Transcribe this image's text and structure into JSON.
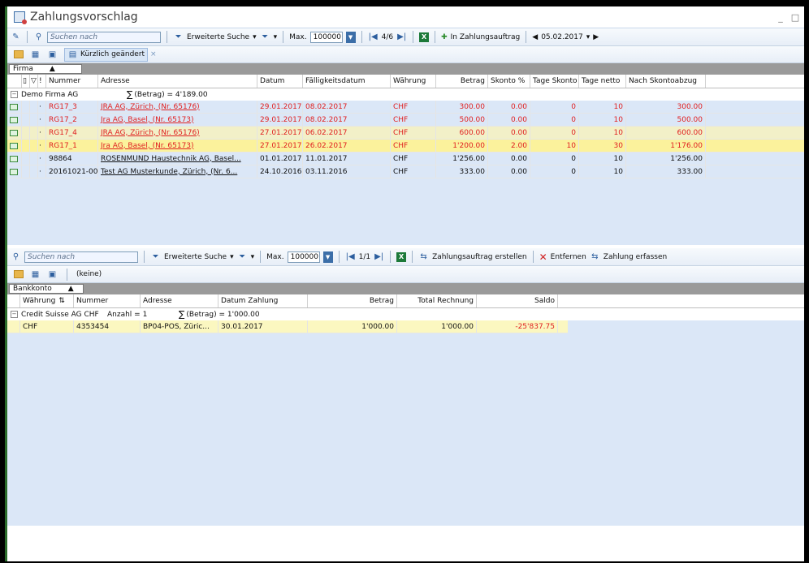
{
  "window": {
    "title": "Zahlungsvorschlag",
    "min_btn": "_",
    "max_btn": "□"
  },
  "top_toolbar": {
    "search_placeholder": "Suchen nach",
    "extended_search": "Erweiterte Suche",
    "max_label": "Max.",
    "max_value": "100000",
    "page": "4/6",
    "to_order": "In Zahlungsauftrag",
    "date": "05.02.2017"
  },
  "top_toolbar2": {
    "recent": "Kürzlich geändert",
    "close": "×"
  },
  "top_group": {
    "field": "Firma"
  },
  "top_columns": [
    "Nummer",
    "Adresse",
    "Datum",
    "Fälligkeitsdatum",
    "Währung",
    "Betrag",
    "Skonto %",
    "Tage Skonto",
    "Tage netto",
    "Nach Skontoabzug"
  ],
  "top_grouprow": {
    "company": "Demo Firma AG",
    "sum": "(Betrag) = 4'189.00"
  },
  "top_rows": [
    {
      "nummer": "RG17_3",
      "adresse": "JRA AG, Zürich, (Nr. 65176)",
      "datum": "29.01.2017",
      "faellig": "08.02.2017",
      "waehrung": "CHF",
      "betrag": "300.00",
      "skonto": "0.00",
      "tage_skonto": "0",
      "tage_netto": "10",
      "nach": "300.00",
      "style": "red",
      "bg": "#dbe7f7"
    },
    {
      "nummer": "RG17_2",
      "adresse": "Jra AG, Basel, (Nr. 65173)",
      "datum": "29.01.2017",
      "faellig": "08.02.2017",
      "waehrung": "CHF",
      "betrag": "500.00",
      "skonto": "0.00",
      "tage_skonto": "0",
      "tage_netto": "10",
      "nach": "500.00",
      "style": "red",
      "bg": "#dbe7f7"
    },
    {
      "nummer": "RG17_4",
      "adresse": "JRA AG, Zürich, (Nr. 65176)",
      "datum": "27.01.2017",
      "faellig": "06.02.2017",
      "waehrung": "CHF",
      "betrag": "600.00",
      "skonto": "0.00",
      "tage_skonto": "0",
      "tage_netto": "10",
      "nach": "600.00",
      "style": "red",
      "bg": "#f2f0c8"
    },
    {
      "nummer": "RG17_1",
      "adresse": "Jra AG, Basel, (Nr. 65173)",
      "datum": "27.01.2017",
      "faellig": "26.02.2017",
      "waehrung": "CHF",
      "betrag": "1'200.00",
      "skonto": "2.00",
      "tage_skonto": "10",
      "tage_netto": "30",
      "nach": "1'176.00",
      "style": "red",
      "bg": "#fbf29c"
    },
    {
      "nummer": "98864",
      "adresse": "ROSENMUND Haustechnik AG, Basel...",
      "datum": "01.01.2017",
      "faellig": "11.01.2017",
      "waehrung": "CHF",
      "betrag": "1'256.00",
      "skonto": "0.00",
      "tage_skonto": "0",
      "tage_netto": "10",
      "nach": "1'256.00",
      "style": "black",
      "bg": "#dbe7f7"
    },
    {
      "nummer": "20161021-002",
      "adresse": "Test AG Musterkunde, Zürich, (Nr. 6...",
      "datum": "24.10.2016",
      "faellig": "03.11.2016",
      "waehrung": "CHF",
      "betrag": "333.00",
      "skonto": "0.00",
      "tage_skonto": "0",
      "tage_netto": "10",
      "nach": "333.00",
      "style": "black",
      "bg": "#dbe7f7"
    }
  ],
  "bottom_toolbar": {
    "search_placeholder": "Suchen nach",
    "extended_search": "Erweiterte Suche",
    "max_label": "Max.",
    "max_value": "100000",
    "page": "1/1",
    "create_order": "Zahlungsauftrag erstellen",
    "remove": "Entfernen",
    "record_payment": "Zahlung erfassen"
  },
  "bottom_toolbar2": {
    "none": "(keine)"
  },
  "bottom_group": {
    "field": "Bankkonto"
  },
  "bottom_columns": [
    "Währung",
    "Nummer",
    "Adresse",
    "Datum Zahlung",
    "Betrag",
    "Total Rechnung",
    "Saldo"
  ],
  "bottom_grouprow": {
    "bank": "Credit Suisse AG CHF",
    "count": "Anzahl = 1",
    "sum": "(Betrag) = 1'000.00"
  },
  "bottom_rows": [
    {
      "waehrung": "CHF",
      "nummer": "4353454",
      "adresse": "BP04-POS, Züric...",
      "datum": "30.01.2017",
      "betrag": "1'000.00",
      "total": "1'000.00",
      "saldo": "-25'837.75"
    }
  ],
  "colors": {
    "accent": "#3b6ea8",
    "negative": "#e02020",
    "highlight": "#fbf29c"
  }
}
